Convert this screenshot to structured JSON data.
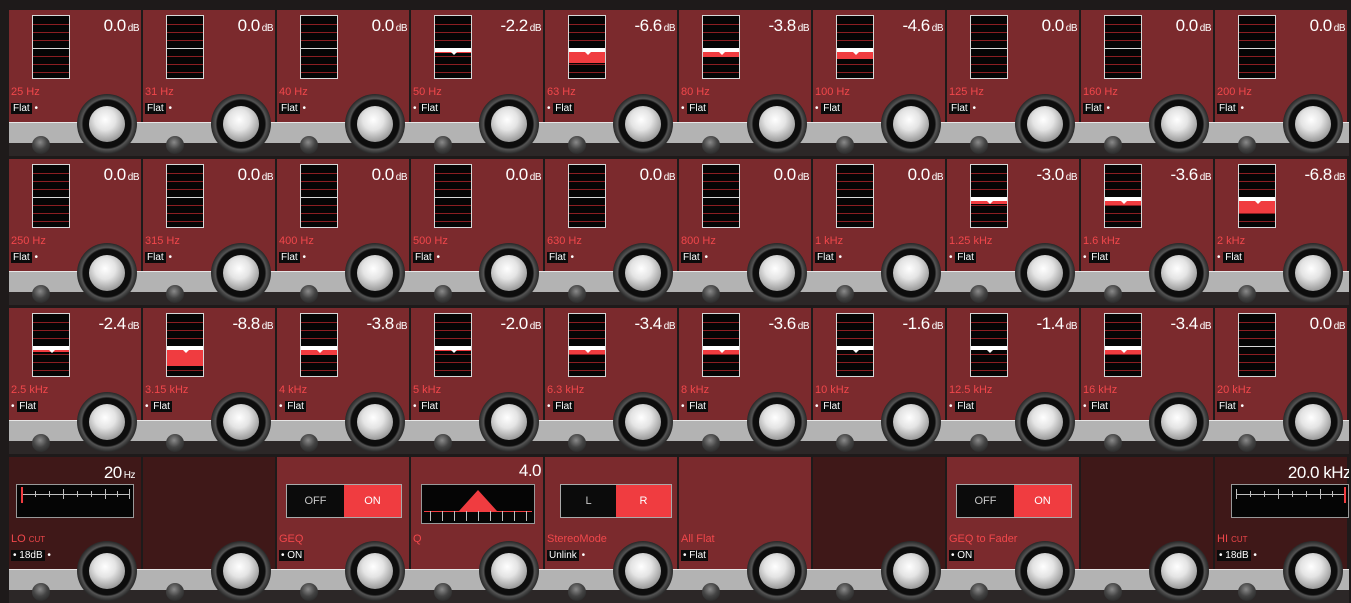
{
  "units": {
    "db": "dB",
    "hz": "Hz"
  },
  "flat_label": "Flat",
  "bands": [
    {
      "freq": "25 Hz",
      "gain": "0.0",
      "gain_db": 0,
      "dot": "right"
    },
    {
      "freq": "31 Hz",
      "gain": "0.0",
      "gain_db": 0,
      "dot": "right"
    },
    {
      "freq": "40 Hz",
      "gain": "0.0",
      "gain_db": 0,
      "dot": "right"
    },
    {
      "freq": "50 Hz",
      "gain": "-2.2",
      "gain_db": -2.2,
      "dot": "left"
    },
    {
      "freq": "63 Hz",
      "gain": "-6.6",
      "gain_db": -6.6,
      "dot": "left"
    },
    {
      "freq": "80 Hz",
      "gain": "-3.8",
      "gain_db": -3.8,
      "dot": "left"
    },
    {
      "freq": "100 Hz",
      "gain": "-4.6",
      "gain_db": -4.6,
      "dot": "left"
    },
    {
      "freq": "125 Hz",
      "gain": "0.0",
      "gain_db": 0,
      "dot": "right"
    },
    {
      "freq": "160 Hz",
      "gain": "0.0",
      "gain_db": 0,
      "dot": "right"
    },
    {
      "freq": "200 Hz",
      "gain": "0.0",
      "gain_db": 0,
      "dot": "right"
    },
    {
      "freq": "250 Hz",
      "gain": "0.0",
      "gain_db": 0,
      "dot": "right"
    },
    {
      "freq": "315 Hz",
      "gain": "0.0",
      "gain_db": 0,
      "dot": "right"
    },
    {
      "freq": "400 Hz",
      "gain": "0.0",
      "gain_db": 0,
      "dot": "right"
    },
    {
      "freq": "500 Hz",
      "gain": "0.0",
      "gain_db": 0,
      "dot": "right"
    },
    {
      "freq": "630 Hz",
      "gain": "0.0",
      "gain_db": 0,
      "dot": "right"
    },
    {
      "freq": "800 Hz",
      "gain": "0.0",
      "gain_db": 0,
      "dot": "right"
    },
    {
      "freq": "1 kHz",
      "gain": "0.0",
      "gain_db": 0,
      "dot": "right"
    },
    {
      "freq": "1.25 kHz",
      "gain": "-3.0",
      "gain_db": -3.0,
      "dot": "left"
    },
    {
      "freq": "1.6 kHz",
      "gain": "-3.6",
      "gain_db": -3.6,
      "dot": "left"
    },
    {
      "freq": "2 kHz",
      "gain": "-6.8",
      "gain_db": -6.8,
      "dot": "left"
    },
    {
      "freq": "2.5 kHz",
      "gain": "-2.4",
      "gain_db": -2.4,
      "dot": "left"
    },
    {
      "freq": "3.15 kHz",
      "gain": "-8.8",
      "gain_db": -8.8,
      "dot": "left"
    },
    {
      "freq": "4 kHz",
      "gain": "-3.8",
      "gain_db": -3.8,
      "dot": "left"
    },
    {
      "freq": "5 kHz",
      "gain": "-2.0",
      "gain_db": -2.0,
      "dot": "left"
    },
    {
      "freq": "6.3 kHz",
      "gain": "-3.4",
      "gain_db": -3.4,
      "dot": "left"
    },
    {
      "freq": "8 kHz",
      "gain": "-3.6",
      "gain_db": -3.6,
      "dot": "left"
    },
    {
      "freq": "10 kHz",
      "gain": "-1.6",
      "gain_db": -1.6,
      "dot": "left"
    },
    {
      "freq": "12.5 kHz",
      "gain": "-1.4",
      "gain_db": -1.4,
      "dot": "left"
    },
    {
      "freq": "16 kHz",
      "gain": "-3.4",
      "gain_db": -3.4,
      "dot": "left"
    },
    {
      "freq": "20 kHz",
      "gain": "0.0",
      "gain_db": 0,
      "dot": "right"
    }
  ],
  "controls": {
    "lo_cut": {
      "value": "20",
      "unit": "Hz",
      "label_main": "LO",
      "label_sub": "CUT",
      "setting": "18dB"
    },
    "geq": {
      "off_label": "OFF",
      "on_label": "ON",
      "active": "ON",
      "label": "GEQ",
      "setting": "ON"
    },
    "q": {
      "value": "4.0",
      "label": "Q"
    },
    "stereo": {
      "left_label": "L",
      "right_label": "R",
      "active": "R",
      "label": "StereoMode",
      "setting": "Unlink"
    },
    "all_flat": {
      "label": "All Flat",
      "setting": "Flat"
    },
    "geq_to_fader": {
      "off_label": "OFF",
      "on_label": "ON",
      "active": "ON",
      "label": "GEQ to Fader",
      "setting": "ON"
    },
    "hi_cut": {
      "value": "20.0 kHz",
      "label_main": "HI",
      "label_sub": "CUT",
      "setting": "18dB"
    }
  },
  "colors": {
    "panel": "#7b2a2d",
    "accent": "#f03c40",
    "label": "#f0474b"
  }
}
